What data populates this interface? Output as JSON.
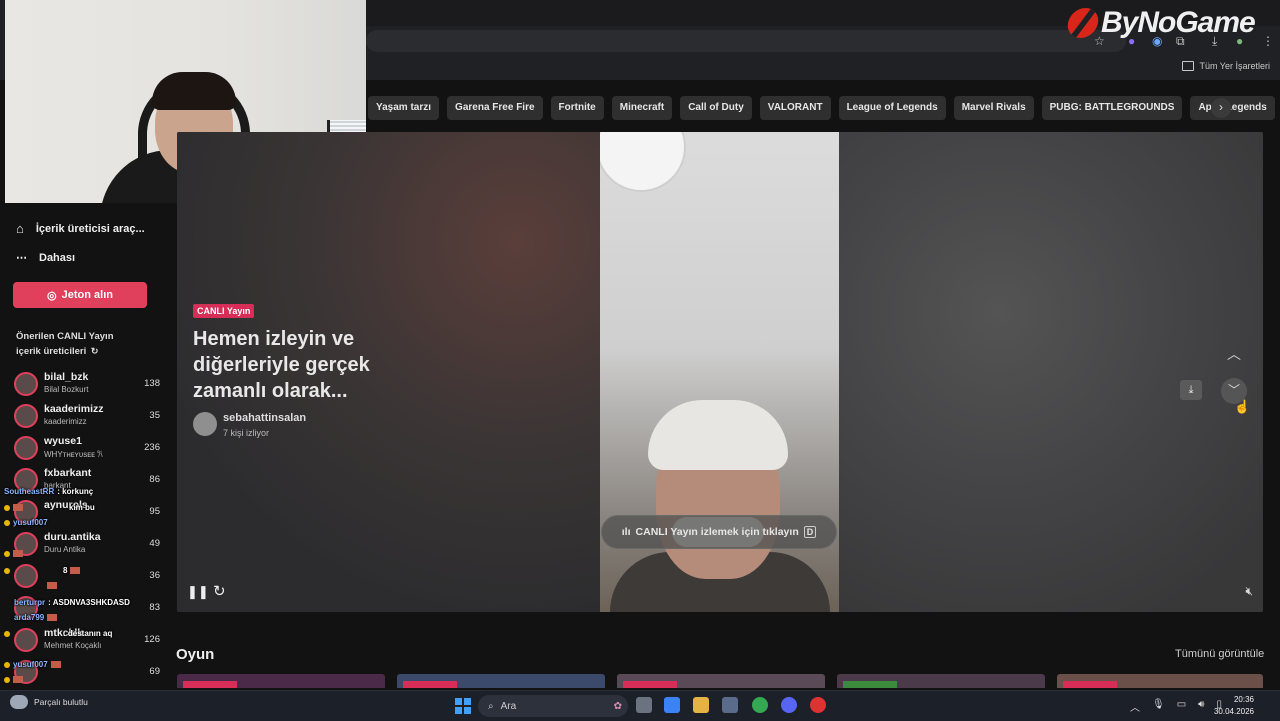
{
  "watermark": {
    "brand": "ByNoGame"
  },
  "browser": {
    "bookmarks_all": "Tüm Yer İşaretleri"
  },
  "categories": [
    "Yaşam tarzı",
    "Garena Free Fire",
    "Fortnite",
    "Minecraft",
    "Call of Duty",
    "VALORANT",
    "League of Legends",
    "Marvel Rivals",
    "PUBG: BATTLEGROUNDS",
    "Apex Legends"
  ],
  "sidebar": {
    "creator_tools": "İçerik üreticisi araç...",
    "more": "Dahası",
    "coins_button": "Jeton alın",
    "suggested_title": "Önerilen CANLI Yayın içerik üreticileri",
    "creators": [
      {
        "name": "bilal_bzk",
        "sub": "Bilal Bozkurt",
        "count": "138"
      },
      {
        "name": "kaaderimizz",
        "sub": "kaaderimizz",
        "count": "35"
      },
      {
        "name": "wyuse1",
        "sub": "WHYᴛʜᴇʏᴜsᴇᴇ 𐙚",
        "count": "236"
      },
      {
        "name": "fxbarkant",
        "sub": "barkant",
        "count": "86"
      },
      {
        "name": "aynurols",
        "sub": "",
        "count": "95"
      },
      {
        "name": "duru.antika",
        "sub": "Duru Antika",
        "count": "49"
      },
      {
        "name": "",
        "sub": "",
        "count": "36"
      },
      {
        "name": "",
        "sub": "",
        "count": "83"
      },
      {
        "name": "",
        "sub": "",
        "count": "126"
      },
      {
        "name": "mtkcklk",
        "sub": "Mehmet Koçaklı",
        "count": ""
      },
      {
        "name": "",
        "sub": "",
        "count": "69"
      }
    ]
  },
  "chat": [
    {
      "user": "SoutheastRR",
      "msg": ": korkunç"
    },
    {
      "user": "",
      "msg": "kim bu"
    },
    {
      "user": "yusuf007",
      "msg": ""
    },
    {
      "user": "",
      "msg": ""
    },
    {
      "user": "",
      "msg": "8"
    },
    {
      "user": "",
      "msg": ""
    },
    {
      "user": "berturpr",
      "msg": ": ASDNVA3SHKDASD"
    },
    {
      "user": "arda799",
      "msg": ""
    },
    {
      "user": "",
      "msg": ": destanın aq"
    },
    {
      "user": "",
      "msg": ""
    },
    {
      "user": "yusuf007",
      "msg": ""
    },
    {
      "user": "",
      "msg": ""
    }
  ],
  "player": {
    "live_badge": "CANLI Yayın",
    "headline": "Hemen izleyin ve diğerleriyle gerçek zamanlı olarak...",
    "host_name": "sebahattinsalan",
    "host_viewers": "7 kişi izliyor",
    "click_to_watch": "CANLI Yayın izlemek için tıklayın",
    "click_key": "D"
  },
  "section": {
    "title": "Oyun",
    "view_all": "Tümünü görüntüle"
  },
  "taskbar": {
    "weather": "Parçalı bulutlu",
    "search": "Ara",
    "time": "20:36",
    "date": "30.04.2026"
  },
  "colors": {
    "accent": "#e0405c",
    "live": "#d72d57",
    "background": "#121212"
  }
}
